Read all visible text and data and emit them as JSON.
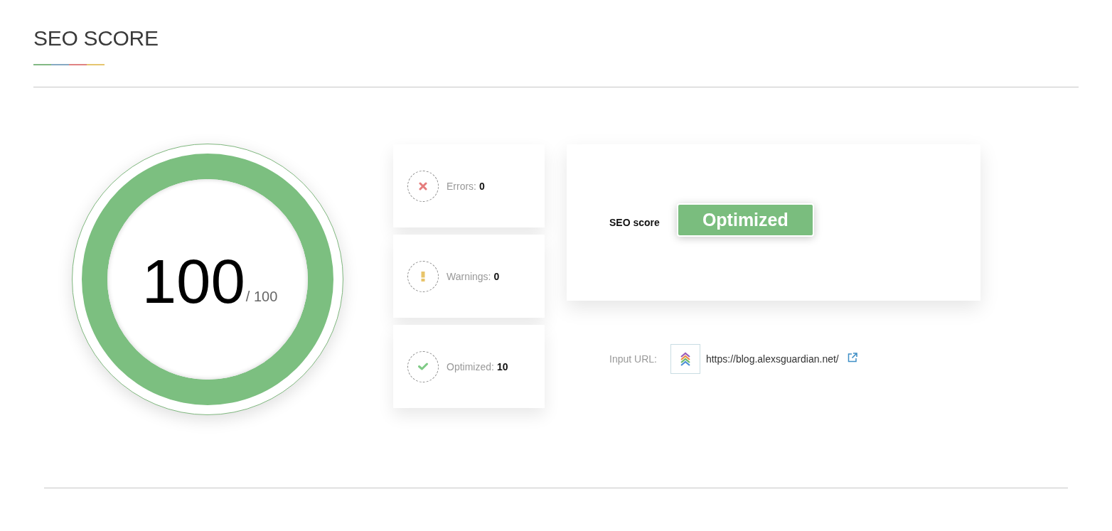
{
  "title": "SEO SCORE",
  "score": {
    "value": "100",
    "max": "/ 100",
    "level": 1
  },
  "stats": [
    {
      "kind": "error",
      "label": "Errors:",
      "value": "0"
    },
    {
      "kind": "warning",
      "label": "Warnings:",
      "value": "0"
    },
    {
      "kind": "optimized",
      "label": "Optimized:",
      "value": "10"
    }
  ],
  "status": {
    "label": "SEO score",
    "badge": "Optimized"
  },
  "input_url": {
    "label": "Input URL:",
    "url": "https://blog.alexsguardian.net/"
  }
}
